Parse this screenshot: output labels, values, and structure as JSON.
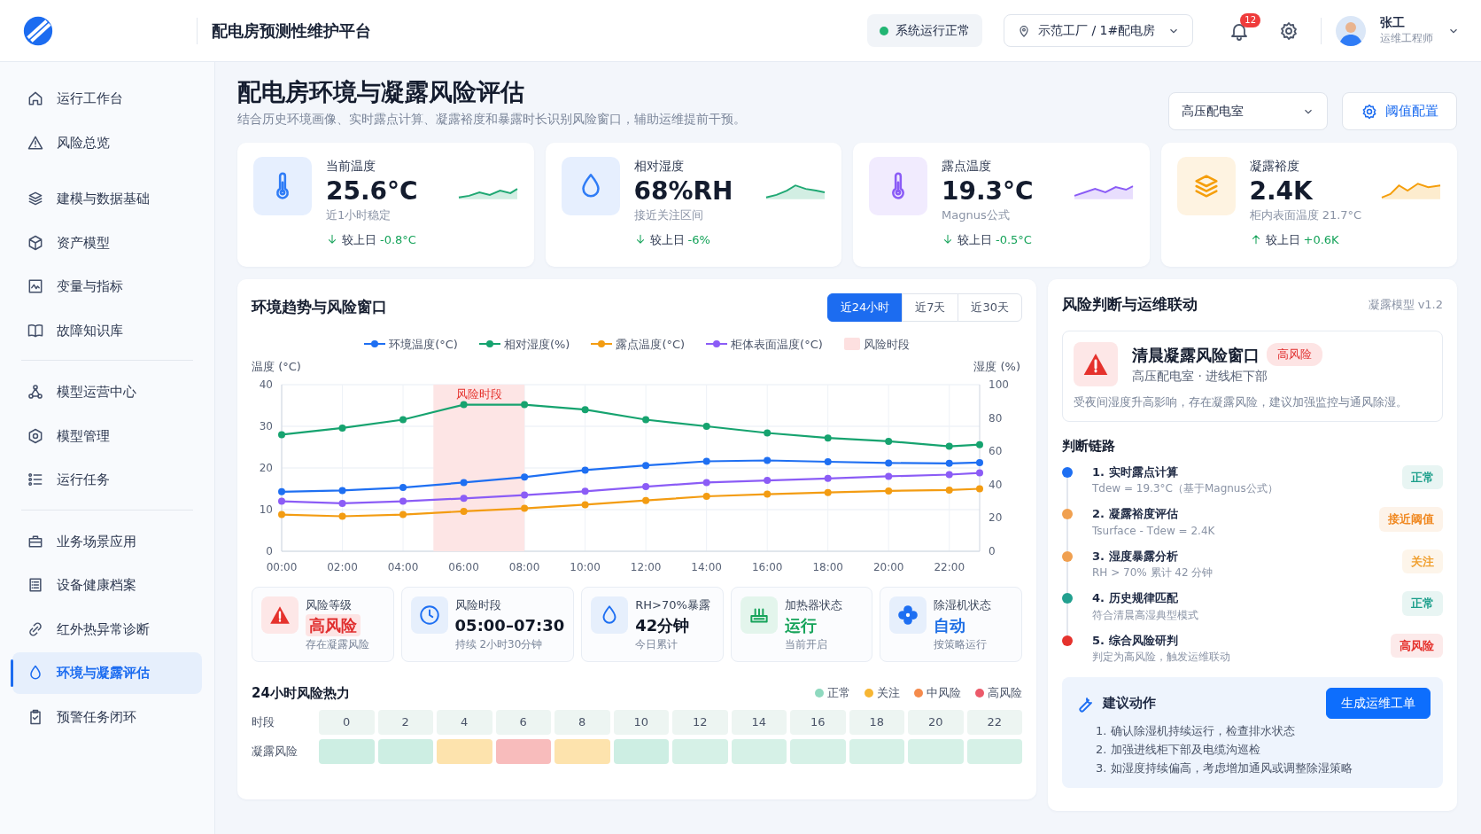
{
  "header": {
    "title": "配电房预测性维护平台",
    "status": {
      "label": "系统运行正常",
      "color": "#22b573"
    },
    "location": "示范工厂 / 1#配电房",
    "notifications": "12",
    "user": {
      "name": "张工",
      "role": "运维工程师"
    }
  },
  "sidebar": {
    "groups": [
      {
        "divider": false,
        "items": [
          {
            "label": "运行工作台",
            "selected": false
          },
          {
            "label": "风险总览",
            "selected": false
          }
        ]
      },
      {
        "divider": false,
        "items": [
          {
            "label": "建模与数据基础",
            "selected": false
          },
          {
            "label": "资产模型",
            "selected": false
          },
          {
            "label": "变量与指标",
            "selected": false
          },
          {
            "label": "故障知识库",
            "selected": false
          }
        ]
      },
      {
        "divider": true,
        "items": [
          {
            "label": "模型运营中心",
            "selected": false
          },
          {
            "label": "模型管理",
            "selected": false
          },
          {
            "label": "运行任务",
            "selected": false
          }
        ]
      },
      {
        "divider": true,
        "items": [
          {
            "label": "业务场景应用",
            "selected": false
          },
          {
            "label": "设备健康档案",
            "selected": false
          },
          {
            "label": "红外热异常诊断",
            "selected": false
          },
          {
            "label": "环境与凝露评估",
            "selected": true
          },
          {
            "label": "预警任务闭环",
            "selected": false
          }
        ]
      }
    ]
  },
  "page": {
    "title": "配电房环境与凝露风险评估",
    "subtitle": "结合历史环境画像、实时露点计算、凝露裕度和暴露时长识别风险窗口，辅助运维提前干预。",
    "room_select": "高压配电室",
    "config_button": "阈值配置"
  },
  "kpis": [
    {
      "label": "当前温度",
      "value": "25.6°C",
      "note": "近1小时稳定",
      "delta_label": "较上日",
      "delta": "-0.8°C",
      "kind": "down",
      "color": "#2f7cf6"
    },
    {
      "label": "相对湿度",
      "value": "68%RH",
      "note": "接近关注区间",
      "delta_label": "较上日",
      "delta": "-6%",
      "kind": "down",
      "color": "#2f7cf6"
    },
    {
      "label": "露点温度",
      "value": "19.3°C",
      "note": "Magnus公式",
      "delta_label": "较上日",
      "delta": "-0.5°C",
      "kind": "down",
      "color": "#8b5cf6"
    },
    {
      "label": "凝露裕度",
      "value": "2.4K",
      "note": "柜内表面温度 21.7°C",
      "delta_label": "较上日",
      "delta": "+0.6K",
      "kind": "up",
      "color": "#f59e0b"
    }
  ],
  "trend": {
    "title": "环境趋势与风险窗口",
    "band_legend": "风险时段",
    "tabs": [
      {
        "label": "近24小时",
        "selected": true
      },
      {
        "label": "近7天",
        "selected": false
      },
      {
        "label": "近30天",
        "selected": false
      }
    ],
    "chart_data": {
      "type": "line",
      "ylabel": "温度 (°C)",
      "y2label": "湿度 (%)",
      "x": [
        0,
        2,
        4,
        6,
        8,
        10,
        12,
        14,
        16,
        18,
        20,
        22,
        23
      ],
      "xticks": [
        {
          "value": 0,
          "label": "00:00"
        },
        {
          "value": 2,
          "label": "02:00"
        },
        {
          "value": 4,
          "label": "04:00"
        },
        {
          "value": 6,
          "label": "06:00"
        },
        {
          "value": 8,
          "label": "08:00"
        },
        {
          "value": 10,
          "label": "10:00"
        },
        {
          "value": 12,
          "label": "12:00"
        },
        {
          "value": 14,
          "label": "14:00"
        },
        {
          "value": 16,
          "label": "16:00"
        },
        {
          "value": 18,
          "label": "18:00"
        },
        {
          "value": 20,
          "label": "20:00"
        },
        {
          "value": 22,
          "label": "22:00"
        }
      ],
      "xlim": [
        0,
        23
      ],
      "ylim": [
        0,
        40
      ],
      "yticks": [
        0,
        10,
        20,
        30,
        40
      ],
      "y2lim": [
        0,
        100
      ],
      "y2ticks": [
        0,
        20,
        40,
        60,
        80,
        100
      ],
      "series": [
        {
          "name": "环境温度(°C)",
          "color": "#1e6ff2",
          "marker": true,
          "values": [
            14.3,
            14.6,
            15.3,
            16.5,
            17.8,
            19.5,
            20.6,
            21.6,
            21.8,
            21.5,
            21.2,
            21.1,
            21.3
          ]
        },
        {
          "name": "相对湿度(%)",
          "color": "#16a36f",
          "axis": "y2",
          "marker": true,
          "values": [
            70,
            74,
            79,
            88,
            88,
            85,
            79,
            75,
            71,
            68,
            66,
            63,
            64
          ]
        },
        {
          "name": "露点温度(°C)",
          "color": "#f39c12",
          "marker": true,
          "values": [
            8.8,
            8.4,
            8.8,
            9.6,
            10.3,
            11.2,
            12.2,
            13.2,
            13.7,
            14.1,
            14.5,
            14.7,
            15.0
          ]
        },
        {
          "name": "柜体表面温度(°C)",
          "color": "#8b5cf6",
          "marker": true,
          "values": [
            12.0,
            11.5,
            12.0,
            12.7,
            13.5,
            14.4,
            15.5,
            16.5,
            17.0,
            17.5,
            18.0,
            18.4,
            18.8
          ]
        }
      ],
      "grid": true,
      "bands": [
        {
          "axis": "x",
          "from": 5,
          "to": 8,
          "label": "风险时段",
          "color": "#fde5e5"
        }
      ]
    }
  },
  "status_cards": [
    {
      "label": "风险等级",
      "value": "高风险",
      "note": "存在凝露风险",
      "kind": "badge",
      "color": "#e02d2d"
    },
    {
      "label": "风险时段",
      "value": "05:00–07:30",
      "note": "持续 2小时30分钟",
      "kind": "text",
      "color": "#111827"
    },
    {
      "label": "RH>70%暴露",
      "value": "42分钟",
      "note": "今日累计",
      "kind": "text",
      "color": "#111827"
    },
    {
      "label": "加热器状态",
      "value": "运行",
      "note": "当前开启",
      "kind": "text",
      "color": "#16a35a"
    },
    {
      "label": "除湿机状态",
      "value": "自动",
      "note": "按策略运行",
      "kind": "text",
      "color": "#1f6fe5"
    }
  ],
  "heatmap": {
    "title": "24小时风险热力",
    "legend": [
      {
        "label": "正常",
        "color": "#8fd9bf"
      },
      {
        "label": "关注",
        "color": "#f7b633"
      },
      {
        "label": "中风险",
        "color": "#f58b4c"
      },
      {
        "label": "高风险",
        "color": "#ec5a6a"
      }
    ],
    "row_labels": [
      "时段",
      "凝露风险"
    ],
    "cells": [
      {
        "hour": "0",
        "color": "#cdeee3"
      },
      {
        "hour": "2",
        "color": "#cdeee3"
      },
      {
        "hour": "4",
        "color": "#fde3ad"
      },
      {
        "hour": "6",
        "color": "#f8bcbc"
      },
      {
        "hour": "8",
        "color": "#fde3ad"
      },
      {
        "hour": "10",
        "color": "#cdeee3"
      },
      {
        "hour": "12",
        "color": "#d6f1e7"
      },
      {
        "hour": "14",
        "color": "#d6f1e7"
      },
      {
        "hour": "16",
        "color": "#d6f1e7"
      },
      {
        "hour": "18",
        "color": "#d6f1e7"
      },
      {
        "hour": "20",
        "color": "#d6f1e7"
      },
      {
        "hour": "22",
        "color": "#d6f1e7"
      }
    ]
  },
  "risk_panel": {
    "title": "风险判断与运维联动",
    "version": "凝露模型 v1.2",
    "alert": {
      "title": "清晨凝露风险窗口",
      "badge": "高风险",
      "location": "高压配电室 · 进线柜下部",
      "description": "受夜间湿度升高影响，存在凝露风险，建议加强监控与通风除湿。"
    },
    "chain_title": "判断链路",
    "steps": [
      {
        "title": "1. 实时露点计算",
        "detail": "Tdew = 19.3°C（基于Magnus公式）",
        "status": "正常",
        "color": "#1e6ff2",
        "kind": "normal"
      },
      {
        "title": "2. 凝露裕度评估",
        "detail": "Tsurface - Tdew = 2.4K",
        "status": "接近阈值",
        "color": "#f0a050",
        "kind": "near"
      },
      {
        "title": "3. 湿度暴露分析",
        "detail": "RH > 70% 累计 42 分钟",
        "status": "关注",
        "color": "#f0a050",
        "kind": "watch"
      },
      {
        "title": "4. 历史规律匹配",
        "detail": "符合清晨高湿典型模式",
        "status": "正常",
        "color": "#22a08f",
        "kind": "normal"
      },
      {
        "title": "5. 综合风险研判",
        "detail": "判定为高风险，触发运维联动",
        "status": "高风险",
        "color": "#e5322d",
        "kind": "high"
      }
    ],
    "actions": {
      "title": "建议动作",
      "button": "生成运维工单",
      "items": [
        "1. 确认除湿机持续运行，检查排水状态",
        "2. 加强进线柜下部及电缆沟巡检",
        "3. 如湿度持续偏高，考虑增加通风或调整除湿策略"
      ]
    }
  }
}
